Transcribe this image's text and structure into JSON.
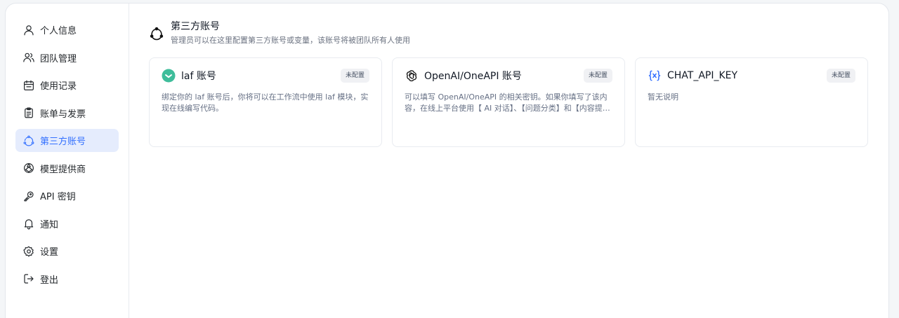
{
  "sidebar": {
    "items": [
      {
        "label": "个人信息",
        "icon": "user-icon",
        "active": false
      },
      {
        "label": "团队管理",
        "icon": "team-icon",
        "active": false
      },
      {
        "label": "使用记录",
        "icon": "calendar-icon",
        "active": false
      },
      {
        "label": "账单与发票",
        "icon": "clipboard-icon",
        "active": false
      },
      {
        "label": "第三方账号",
        "icon": "triangle-dots-icon",
        "active": true
      },
      {
        "label": "模型提供商",
        "icon": "model-icon",
        "active": false
      },
      {
        "label": "API 密钥",
        "icon": "key-icon",
        "active": false
      },
      {
        "label": "通知",
        "icon": "bell-icon",
        "active": false
      },
      {
        "label": "设置",
        "icon": "gear-icon",
        "active": false
      },
      {
        "label": "登出",
        "icon": "logout-icon",
        "active": false
      }
    ]
  },
  "header": {
    "title": "第三方账号",
    "description": "管理员可以在这里配置第三方账号或变量，该账号将被团队所有人使用"
  },
  "cards": [
    {
      "name": "laf 账号",
      "badge": "未配置",
      "icon": "laf-logo-icon",
      "description": "绑定你的 laf 账号后，你将可以在工作流中使用 laf 模块，实现在线编写代码。"
    },
    {
      "name": "OpenAI/OneAPI 账号",
      "badge": "未配置",
      "icon": "openai-logo-icon",
      "description": "可以填写 OpenAI/OneAPI 的相关密钥。如果你填写了该内容，在线上平台使用【 AI 对话】、【问题分类】和【内容提取】将..."
    },
    {
      "name": "CHAT_API_KEY",
      "badge": "未配置",
      "icon": "variable-icon",
      "description": "暂无说明"
    }
  ],
  "colors": {
    "accent": "#3370ff",
    "active_bg": "#e5ecfd",
    "laf_green": "#3fbd9b"
  }
}
